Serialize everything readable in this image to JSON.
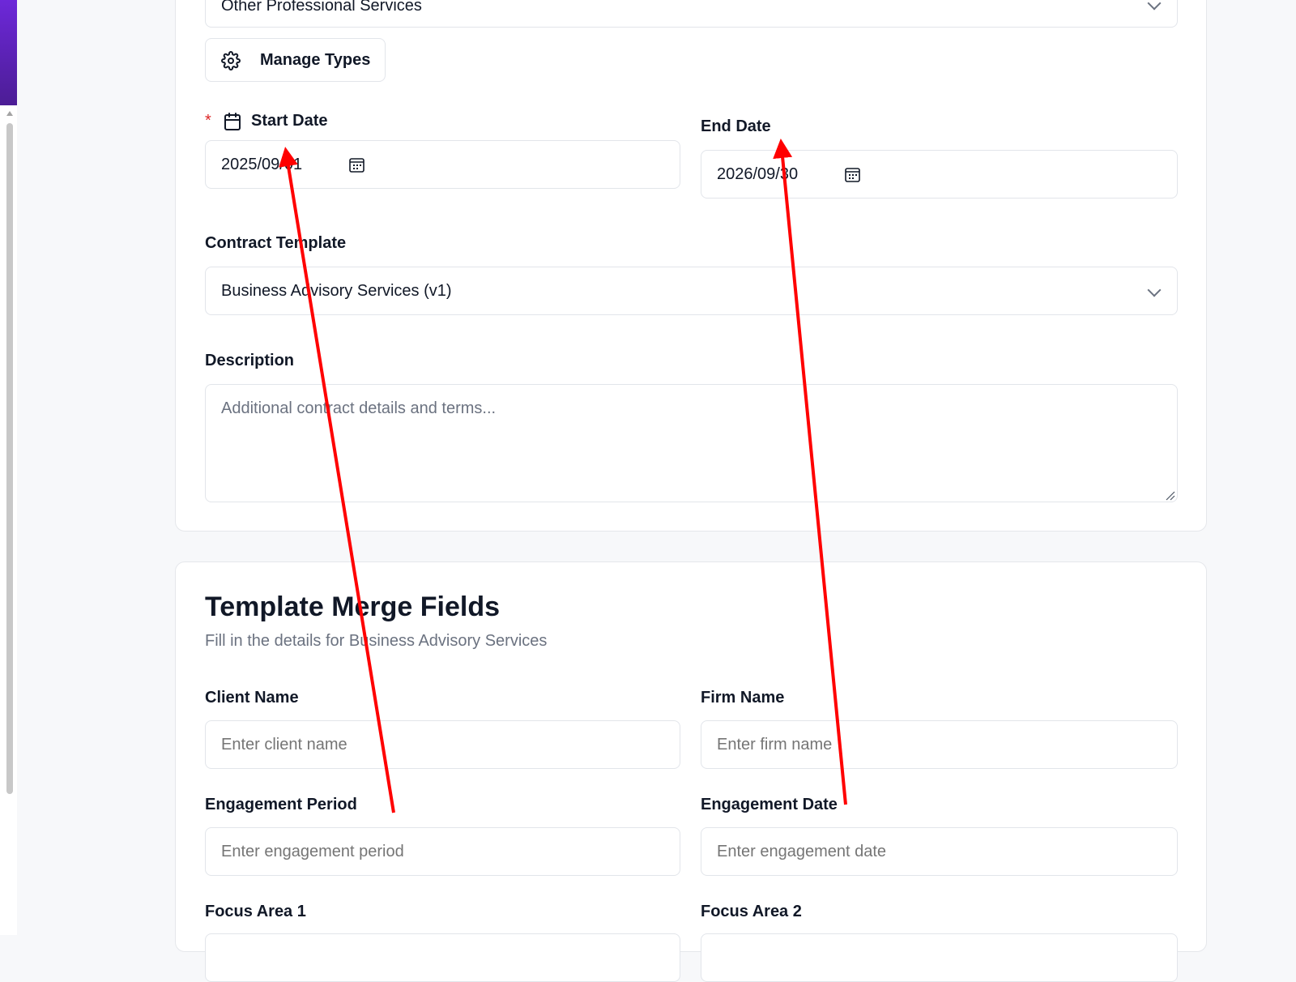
{
  "contract_type": {
    "selected": "Other Professional Services"
  },
  "manage_types": {
    "label": "Manage Types"
  },
  "start_date": {
    "required_mark": "*",
    "label": "Start Date",
    "value": "2025/09/01"
  },
  "end_date": {
    "label": "End Date",
    "value": "2026/09/30"
  },
  "contract_template": {
    "label": "Contract Template",
    "selected": "Business Advisory Services (v1)"
  },
  "description": {
    "label": "Description",
    "placeholder": "Additional contract details and terms..."
  },
  "merge_fields": {
    "title": "Template Merge Fields",
    "subtitle": "Fill in the details for Business Advisory Services",
    "fields": {
      "client_name": {
        "label": "Client Name",
        "placeholder": "Enter client name"
      },
      "firm_name": {
        "label": "Firm Name",
        "placeholder": "Enter firm name"
      },
      "engagement_period": {
        "label": "Engagement Period",
        "placeholder": "Enter engagement period"
      },
      "engagement_date": {
        "label": "Engagement Date",
        "placeholder": "Enter engagement date"
      },
      "focus_area_1": {
        "label": "Focus Area 1"
      },
      "focus_area_2": {
        "label": "Focus Area 2"
      }
    }
  },
  "colors": {
    "accent": "#6d28d9",
    "required": "#dc2626",
    "annotation_arrow": "#ff0000"
  },
  "icons": {
    "manage_types": "gear-icon",
    "start_date": "calendar-icon",
    "date_picker": "calendar-grid-icon",
    "select": "chevron-down-icon",
    "textarea": "resize-handle-icon"
  }
}
